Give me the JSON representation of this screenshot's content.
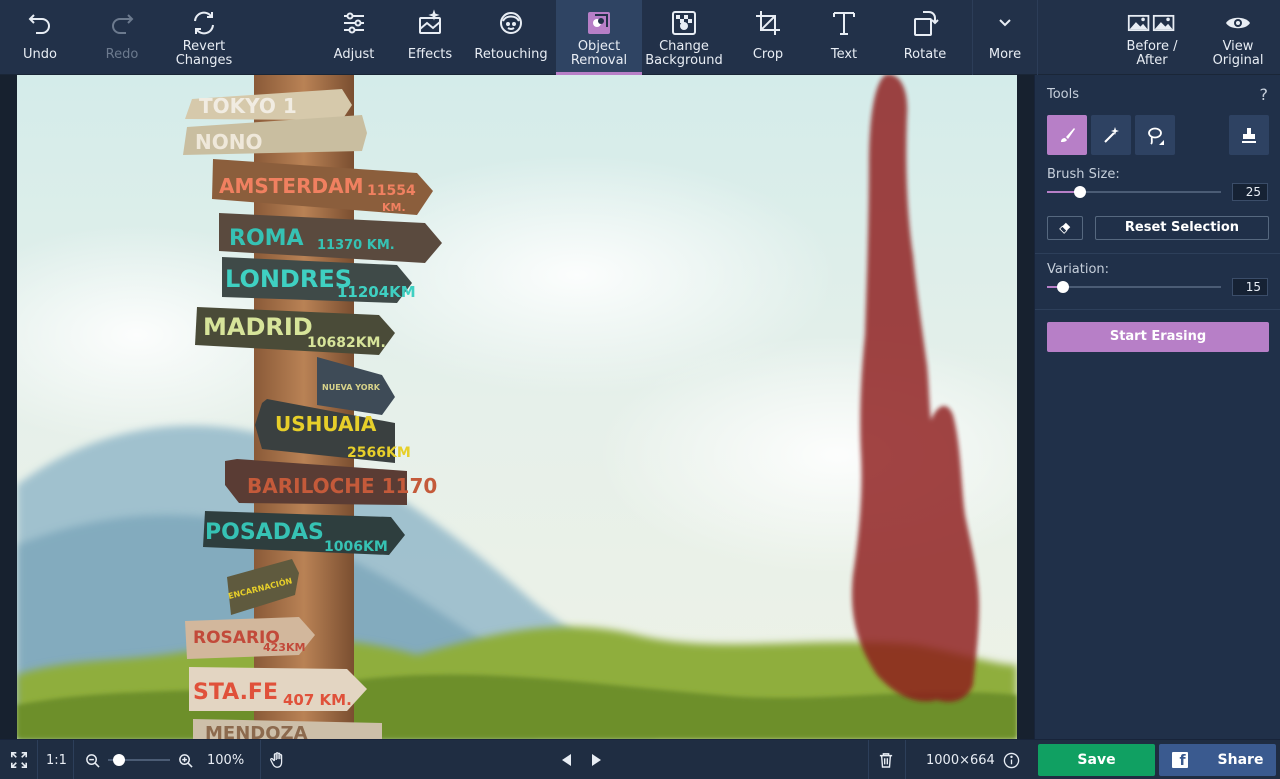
{
  "toolbar": {
    "undo": "Undo",
    "redo": "Redo",
    "revert": "Revert\nChanges",
    "adjust": "Adjust",
    "effects": "Effects",
    "retouching": "Retouching",
    "object_removal": "Object\nRemoval",
    "change_background": "Change\nBackground",
    "crop": "Crop",
    "text": "Text",
    "rotate": "Rotate",
    "more": "More",
    "before_after": "Before /\nAfter",
    "view_original": "View\nOriginal"
  },
  "photo": {
    "signs": [
      {
        "label": "TOKYO 1"
      },
      {
        "label": "NONO"
      },
      {
        "label": "AMSTERDAM"
      },
      {
        "label": "11554"
      },
      {
        "label": "KM."
      },
      {
        "label": "ROMA"
      },
      {
        "label": "11370 KM."
      },
      {
        "label": "LONDRES"
      },
      {
        "label": "11204KM"
      },
      {
        "label": "MADRID"
      },
      {
        "label": "10682KM."
      },
      {
        "label": "NUEVA YORK"
      },
      {
        "label": "USHUAIA"
      },
      {
        "label": "2566KM"
      },
      {
        "label": "BARILOCHE 1170"
      },
      {
        "label": "POSADAS"
      },
      {
        "label": "1006KM"
      },
      {
        "label": "ENCARNACIÓN"
      },
      {
        "label": "ROSARIO"
      },
      {
        "label": "423KM"
      },
      {
        "label": "STA.FE"
      },
      {
        "label": "407 KM."
      },
      {
        "label": "MENDOZA"
      }
    ]
  },
  "panel": {
    "title": "Tools",
    "help": "?",
    "brush_size_label": "Brush Size:",
    "brush_size_value": "25",
    "brush_size_level": 0.19,
    "reset_selection": "Reset Selection",
    "variation_label": "Variation:",
    "variation_value": "15",
    "variation_level": 0.09,
    "start_erasing": "Start Erasing"
  },
  "bottom": {
    "ratio": "1:1",
    "zoom": "100%",
    "zoom_level": 0.18,
    "dimensions": "1000×664",
    "save": "Save",
    "share": "Share"
  },
  "colors": {
    "accent": "#b77fc7",
    "save": "#10a062",
    "share": "#3a5a8f",
    "selection": "#8e1f1f"
  }
}
